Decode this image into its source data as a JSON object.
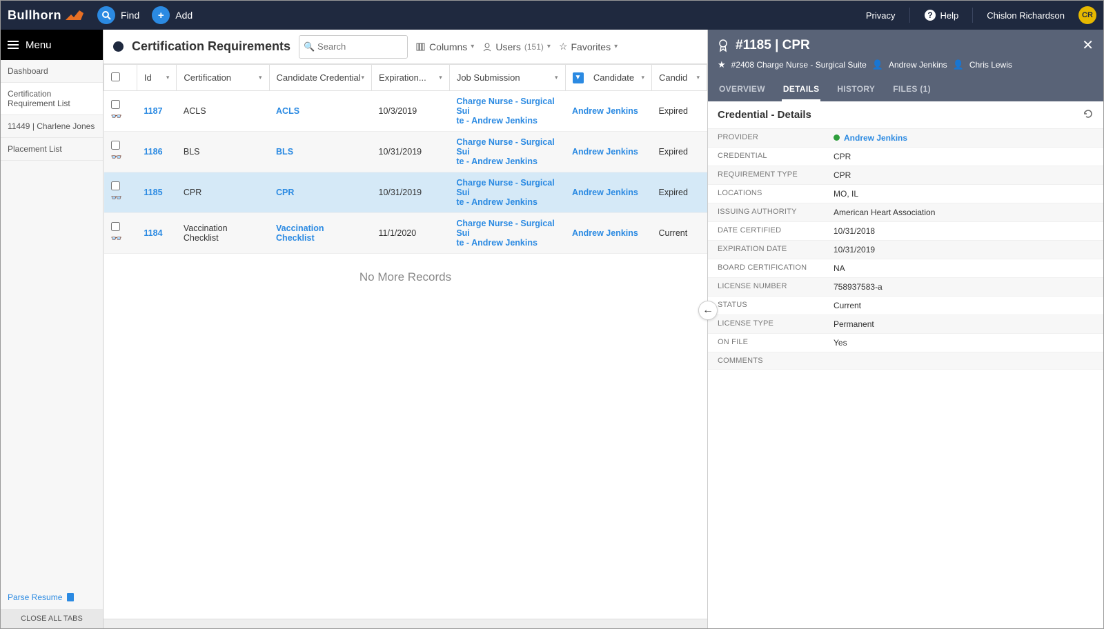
{
  "topbar": {
    "brand": "Bullhorn",
    "find": "Find",
    "add": "Add",
    "privacy": "Privacy",
    "help": "Help",
    "user": "Chislon Richardson",
    "user_initials": "CR"
  },
  "sidebar": {
    "menu": "Menu",
    "items": [
      "Dashboard",
      "Certification Requirement List",
      "11449 | Charlene Jones",
      "Placement List"
    ],
    "parse_resume": "Parse Resume",
    "close_all": "CLOSE ALL TABS"
  },
  "toolbar": {
    "title": "Certification Requirements",
    "search_placeholder": "Search",
    "columns": "Columns",
    "users": "Users",
    "users_count": "(151)",
    "favorites": "Favorites"
  },
  "columns": [
    "Id",
    "Certification",
    "Candidate Credential",
    "Expiration...",
    "Job Submission",
    "Candidate",
    "Candid"
  ],
  "rows": [
    {
      "id": "1187",
      "cert": "ACLS",
      "cred": "ACLS",
      "exp": "10/3/2019",
      "job": "Charge Nurse - Surgical Suite - Andrew Jenkins",
      "cand": "Andrew Jenkins",
      "status": "Expired"
    },
    {
      "id": "1186",
      "cert": "BLS",
      "cred": "BLS",
      "exp": "10/31/2019",
      "job": "Charge Nurse - Surgical Suite - Andrew Jenkins",
      "cand": "Andrew Jenkins",
      "status": "Expired"
    },
    {
      "id": "1185",
      "cert": "CPR",
      "cred": "CPR",
      "exp": "10/31/2019",
      "job": "Charge Nurse - Surgical Suite - Andrew Jenkins",
      "cand": "Andrew Jenkins",
      "status": "Expired",
      "selected": true
    },
    {
      "id": "1184",
      "cert": "Vaccination Checklist",
      "cred": "Vaccination Checklist",
      "exp": "11/1/2020",
      "job": "Charge Nurse - Surgical Suite - Andrew Jenkins",
      "cand": "Andrew Jenkins",
      "status": "Current"
    }
  ],
  "no_more": "No More Records",
  "detail": {
    "title": "#1185 | CPR",
    "breadcrumb_job": "#2408 Charge Nurse - Surgical Suite",
    "breadcrumb_person1": "Andrew Jenkins",
    "breadcrumb_person2": "Chris Lewis",
    "tabs": [
      "OVERVIEW",
      "DETAILS",
      "HISTORY",
      "FILES (1)"
    ],
    "active_tab": 1,
    "section_title": "Credential - Details",
    "fields": [
      {
        "k": "PROVIDER",
        "v": "Andrew Jenkins",
        "link": true,
        "dot": true
      },
      {
        "k": "CREDENTIAL",
        "v": "CPR"
      },
      {
        "k": "REQUIREMENT TYPE",
        "v": "CPR"
      },
      {
        "k": "LOCATIONS",
        "v": "MO, IL"
      },
      {
        "k": "ISSUING AUTHORITY",
        "v": "American Heart Association"
      },
      {
        "k": "DATE CERTIFIED",
        "v": "10/31/2018"
      },
      {
        "k": "EXPIRATION DATE",
        "v": "10/31/2019"
      },
      {
        "k": "BOARD CERTIFICATION",
        "v": "NA"
      },
      {
        "k": "LICENSE NUMBER",
        "v": "758937583-a"
      },
      {
        "k": "STATUS",
        "v": "Current"
      },
      {
        "k": "LICENSE TYPE",
        "v": "Permanent"
      },
      {
        "k": "ON FILE",
        "v": "Yes"
      },
      {
        "k": "COMMENTS",
        "v": ""
      }
    ]
  }
}
